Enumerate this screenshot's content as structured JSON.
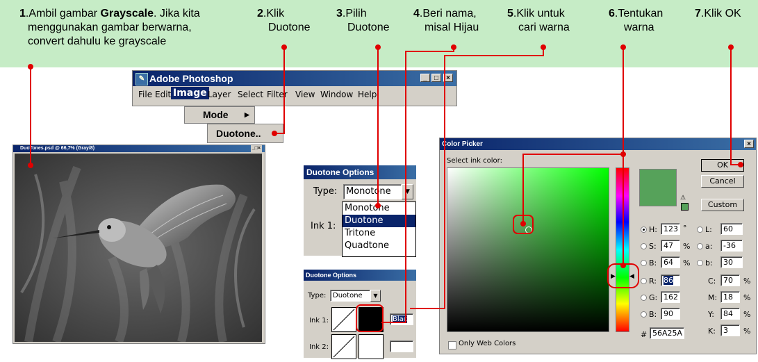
{
  "steps": [
    {
      "num": "1",
      "lines": [
        "Ambil gambar ",
        "Grayscale",
        ". Jika kita",
        "menggunakan gambar berwarna,",
        "convert dahulu ke grayscale"
      ]
    },
    {
      "num": "2",
      "lines": [
        "Klik",
        "Duotone"
      ]
    },
    {
      "num": "3",
      "lines": [
        "Pilih",
        "Duotone"
      ]
    },
    {
      "num": "4",
      "lines": [
        "Beri nama,",
        "misal Hijau"
      ]
    },
    {
      "num": "5",
      "lines": [
        "Klik untuk",
        "cari warna"
      ]
    },
    {
      "num": "6",
      "lines": [
        "Tentukan",
        "warna"
      ]
    },
    {
      "num": "7",
      "lines": [
        "Klik OK"
      ]
    }
  ],
  "photoshop": {
    "title": "Adobe Photoshop",
    "menus": [
      "File",
      "Edit",
      "Image",
      "Layer",
      "Select",
      "Filter",
      "View",
      "Window",
      "Help"
    ],
    "submenu_mode": "Mode",
    "submenu_duotone": "Duotone.."
  },
  "image_window": {
    "title": "DuoTones.psd @ 66,7% (Gray/8)"
  },
  "duotone_top": {
    "title": "Duotone Options",
    "type_label": "Type:",
    "type_value": "Monotone",
    "ink1_label": "Ink 1:",
    "options": [
      "Monotone",
      "Duotone",
      "Tritone",
      "Quadtone"
    ],
    "selected_option": "Duotone"
  },
  "duotone_bottom": {
    "title": "Duotone Options",
    "type_label": "Type:",
    "type_value": "Duotone",
    "ink1_label": "Ink 1:",
    "ink1_name": "Blac",
    "ink2_label": "Ink 2:"
  },
  "color_picker": {
    "title": "Color Picker",
    "prompt": "Select ink color:",
    "ok": "OK",
    "cancel": "Cancel",
    "custom": "Custom",
    "hsb": [
      {
        "label": "H:",
        "value": "123",
        "unit": "°"
      },
      {
        "label": "S:",
        "value": "47",
        "unit": "%"
      },
      {
        "label": "B:",
        "value": "64",
        "unit": "%"
      }
    ],
    "rgb": [
      {
        "label": "R:",
        "value": "86"
      },
      {
        "label": "G:",
        "value": "162"
      },
      {
        "label": "B:",
        "value": "90"
      }
    ],
    "lab": [
      {
        "label": "L:",
        "value": "60"
      },
      {
        "label": "a:",
        "value": "-36"
      },
      {
        "label": "b:",
        "value": "30"
      }
    ],
    "cmyk": [
      {
        "label": "C:",
        "value": "70",
        "unit": "%"
      },
      {
        "label": "M:",
        "value": "18",
        "unit": "%"
      },
      {
        "label": "Y:",
        "value": "84",
        "unit": "%"
      },
      {
        "label": "K:",
        "value": "3",
        "unit": "%"
      }
    ],
    "hash": "#",
    "hex": "56A25A",
    "web_only": "Only Web Colors",
    "swatch_color": "#56a25a"
  },
  "colors": {
    "banner": "#c6ecc6",
    "callout": "#e00000",
    "titlebar": "#0a246a"
  }
}
